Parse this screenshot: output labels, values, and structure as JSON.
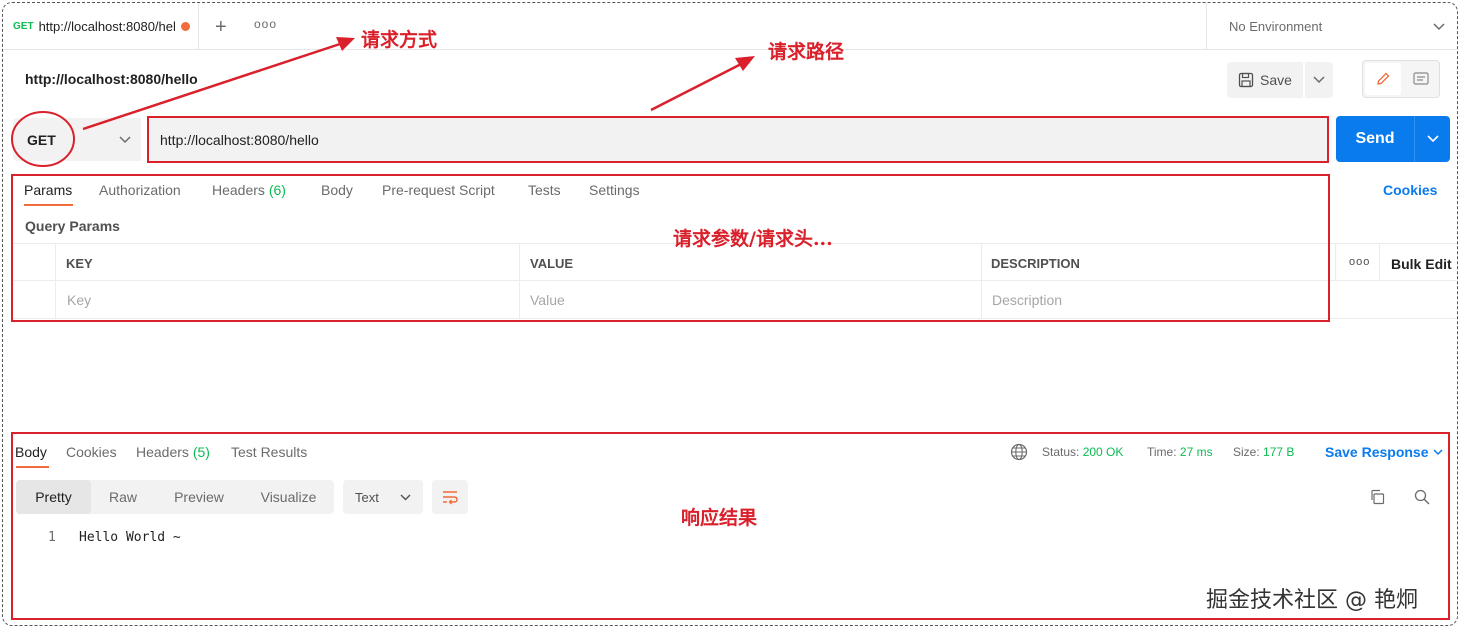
{
  "tabbar": {
    "tab_method": "GET",
    "tab_name": "http://localhost:8080/hello",
    "add_icon": "+",
    "more_icon": "ooo",
    "environment": "No Environment"
  },
  "header": {
    "title": "http://localhost:8080/hello",
    "save_label": "Save"
  },
  "request": {
    "method": "GET",
    "url": "http://localhost:8080/hello",
    "send_label": "Send",
    "tabs": [
      {
        "label": "Params"
      },
      {
        "label": "Authorization"
      },
      {
        "label": "Headers",
        "count": "(6)"
      },
      {
        "label": "Body"
      },
      {
        "label": "Pre-request Script"
      },
      {
        "label": "Tests"
      },
      {
        "label": "Settings"
      }
    ],
    "cookies_label": "Cookies",
    "query_params_label": "Query Params",
    "table": {
      "headers": [
        "KEY",
        "VALUE",
        "DESCRIPTION"
      ],
      "placeholders": [
        "Key",
        "Value",
        "Description"
      ],
      "more_label": "ooo",
      "bulk_edit_label": "Bulk Edit"
    }
  },
  "response": {
    "tabs": [
      {
        "label": "Body"
      },
      {
        "label": "Cookies"
      },
      {
        "label": "Headers",
        "count": "(5)"
      },
      {
        "label": "Test Results"
      }
    ],
    "status_label": "Status:",
    "status_value": "200 OK",
    "time_label": "Time:",
    "time_value": "27 ms",
    "size_label": "Size:",
    "size_value": "177 B",
    "save_response_label": "Save Response",
    "formats": [
      "Pretty",
      "Raw",
      "Preview",
      "Visualize"
    ],
    "text_select": "Text",
    "code": {
      "line_number": "1",
      "text": "Hello World ~"
    }
  },
  "annotations": {
    "method": "请求方式",
    "path": "请求路径",
    "params": "请求参数/请求头...",
    "result": "响应结果"
  },
  "watermark": "掘金技术社区 @ 艳炯",
  "colors": {
    "accent_orange": "#f26b3a",
    "send_blue": "#097bed",
    "status_green": "#0cbb52",
    "annotation_red": "#d9202b"
  }
}
